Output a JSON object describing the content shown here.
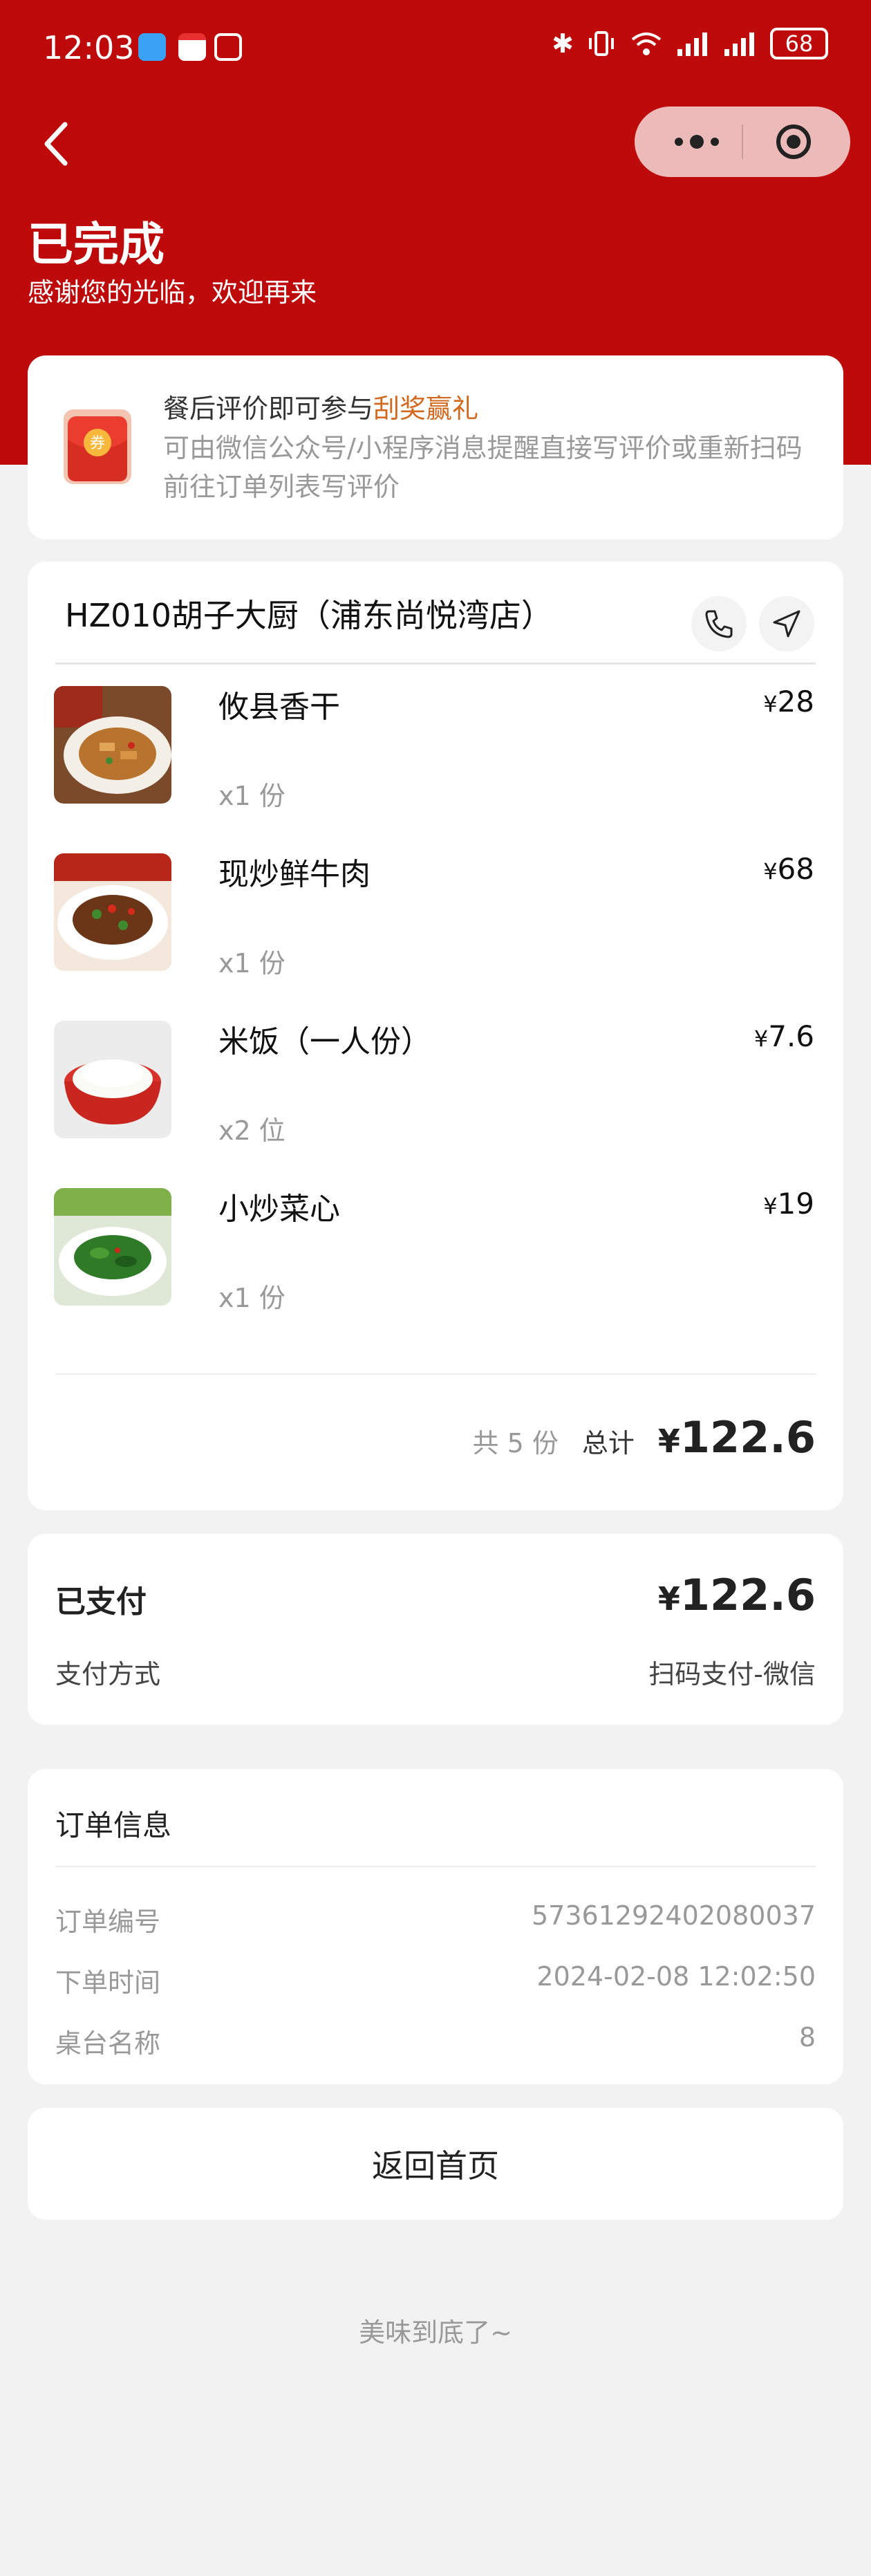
{
  "status_bar": {
    "time": "12:03",
    "battery": "68",
    "icons": [
      "message-app-icon",
      "calendar-app-icon",
      "nfc-icon",
      "bluetooth-icon",
      "vibrate-icon",
      "wifi-icon",
      "signal-icon",
      "signal-icon",
      "battery-icon"
    ]
  },
  "header": {
    "title": "已完成",
    "subtitle": "感谢您的光临，欢迎再来"
  },
  "promo": {
    "title_prefix": "餐后评价即可参与",
    "title_highlight": "刮奖赢礼",
    "description": "可由微信公众号/小程序消息提醒直接写评价或重新扫码前往订单列表写评价",
    "icon_text": "券"
  },
  "order": {
    "store_name": "HZ010胡子大厨（浦东尚悦湾店）",
    "currency": "¥",
    "items": [
      {
        "name": "攸县香干",
        "qty": "x1 份",
        "price": "28"
      },
      {
        "name": "现炒鲜牛肉",
        "qty": "x1 份",
        "price": "68"
      },
      {
        "name": "米饭（一人份）",
        "qty": "x2 位",
        "price": "7.6"
      },
      {
        "name": "小炒菜心",
        "qty": "x1 份",
        "price": "19"
      }
    ],
    "count_text": "共 5 份",
    "total_label": "总计",
    "total": "122.6"
  },
  "payment": {
    "status": "已支付",
    "amount": "122.6",
    "method_label": "支付方式",
    "method_value": "扫码支付-微信"
  },
  "info": {
    "title": "订单信息",
    "rows": [
      {
        "label": "订单编号",
        "value": "5736129240208003​7"
      },
      {
        "label": "下单时间",
        "value": "2024-02-08 12:02:50"
      },
      {
        "label": "桌台名称",
        "value": "8"
      }
    ]
  },
  "home_button": "返回首页",
  "footer": "美味到底了~",
  "colors": {
    "brand_red": "#be0a0a",
    "highlight": "#d2691e"
  }
}
